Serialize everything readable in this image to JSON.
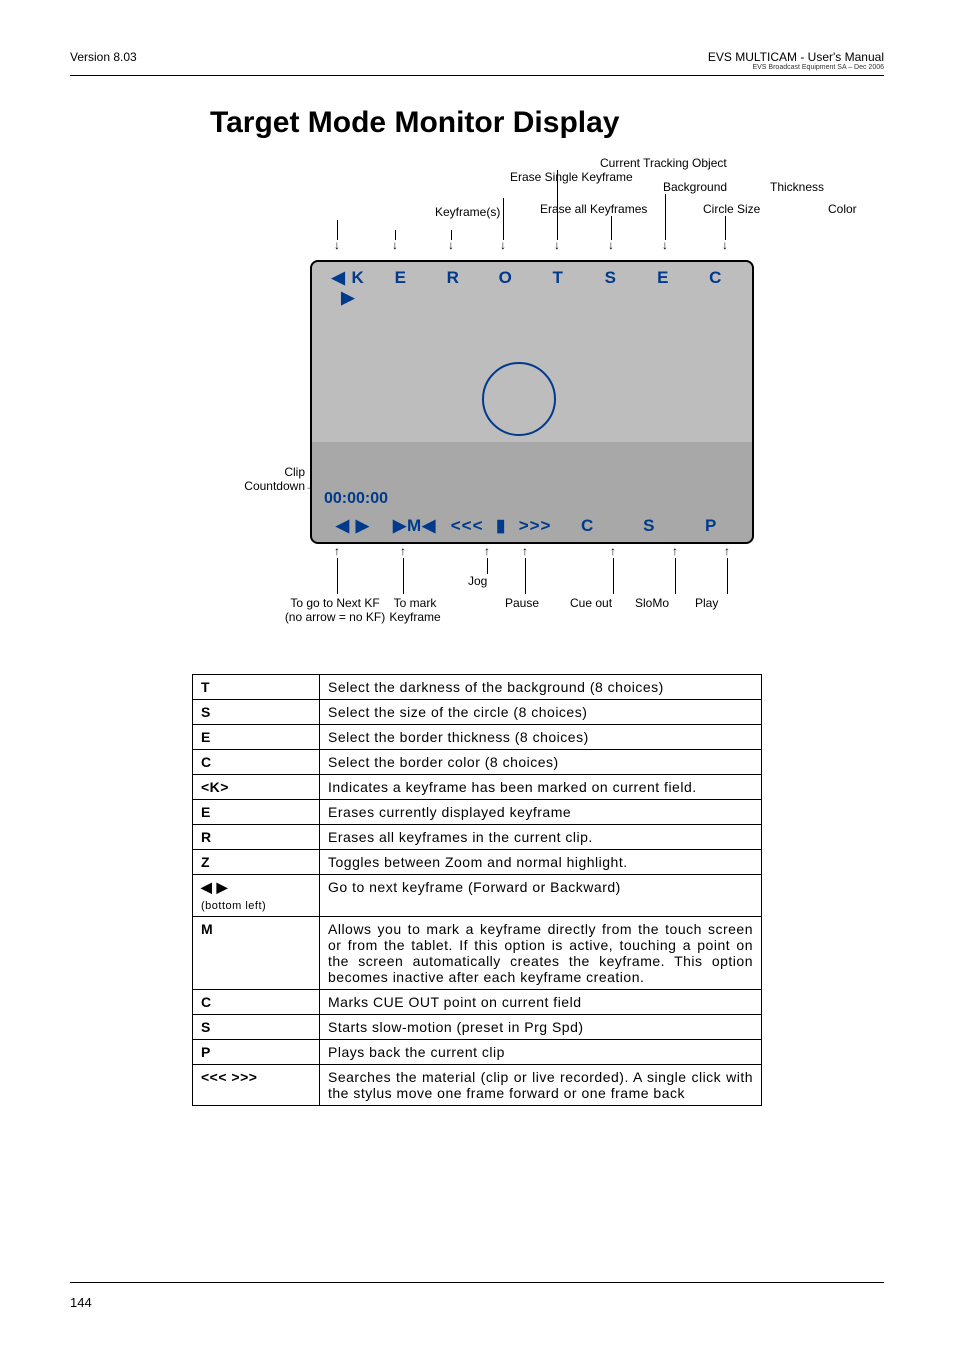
{
  "header": {
    "version": "Version 8.03",
    "product": "EVS MULTICAM  - User's Manual",
    "company": "EVS Broadcast Equipment SA – Dec 2006"
  },
  "title": "Target Mode Monitor Display",
  "diagram": {
    "top_labels": {
      "keyframes": "Keyframe(s)",
      "erase_single": "Erase Single Keyframe",
      "erase_all": "Erase all Keyframes",
      "current_tracking": "Current Tracking Object",
      "background": "Background",
      "circle_size": "Circle Size",
      "thickness": "Thickness",
      "color": "Color"
    },
    "monitor": {
      "top_row": [
        "◀ K ▶",
        "E",
        "R",
        "O",
        "T",
        "S",
        "E",
        "C"
      ],
      "countdown": "00:00:00",
      "bot_row": [
        "◀  ▶",
        "▶M◀",
        "<<<",
        "▮",
        ">>>",
        "C",
        "S",
        "P"
      ]
    },
    "side_label": {
      "clip_countdown_1": "Clip",
      "clip_countdown_2": "Countdown"
    },
    "bottom_labels": {
      "next_kf_1": "To go to Next KF",
      "next_kf_2": "(no arrow = no KF)",
      "mark_kf_1": "To mark",
      "mark_kf_2": "Keyframe",
      "jog": "Jog",
      "pause": "Pause",
      "cue_out": "Cue out",
      "slomo": "SloMo",
      "play": "Play"
    }
  },
  "table": [
    {
      "key": "T",
      "desc": "Select the darkness of the background (8 choices)"
    },
    {
      "key": "S",
      "desc": "Select the size of the circle (8 choices)"
    },
    {
      "key": "E",
      "desc": "Select the border thickness (8 choices)"
    },
    {
      "key": "C",
      "desc": "Select the border color (8 choices)"
    },
    {
      "key": "<K>",
      "desc": "Indicates a keyframe has been marked on current field."
    },
    {
      "key": "E",
      "desc": "Erases currently displayed keyframe"
    },
    {
      "key": "R",
      "desc": "Erases all keyframes in the current clip."
    },
    {
      "key": "Z",
      "desc": "Toggles between Zoom and normal highlight."
    },
    {
      "key": "◀  ▶",
      "sub": "(bottom left)",
      "desc": "Go to next keyframe (Forward or Backward)"
    },
    {
      "key": "M",
      "desc": "Allows you to mark a keyframe directly from the touch screen or from the tablet. If this option is active, touching a point on the screen automatically creates the keyframe. This option becomes inactive after each keyframe creation."
    },
    {
      "key": "C",
      "desc": "Marks CUE OUT point on current field"
    },
    {
      "key": "S",
      "desc": "Starts slow-motion (preset in Prg Spd)"
    },
    {
      "key": "P",
      "desc": "Plays back the current clip"
    },
    {
      "key": "<<<  >>>",
      "desc": "Searches the material (clip or live recorded). A single click with the stylus move one frame forward or one frame back"
    }
  ],
  "page_number": "144"
}
